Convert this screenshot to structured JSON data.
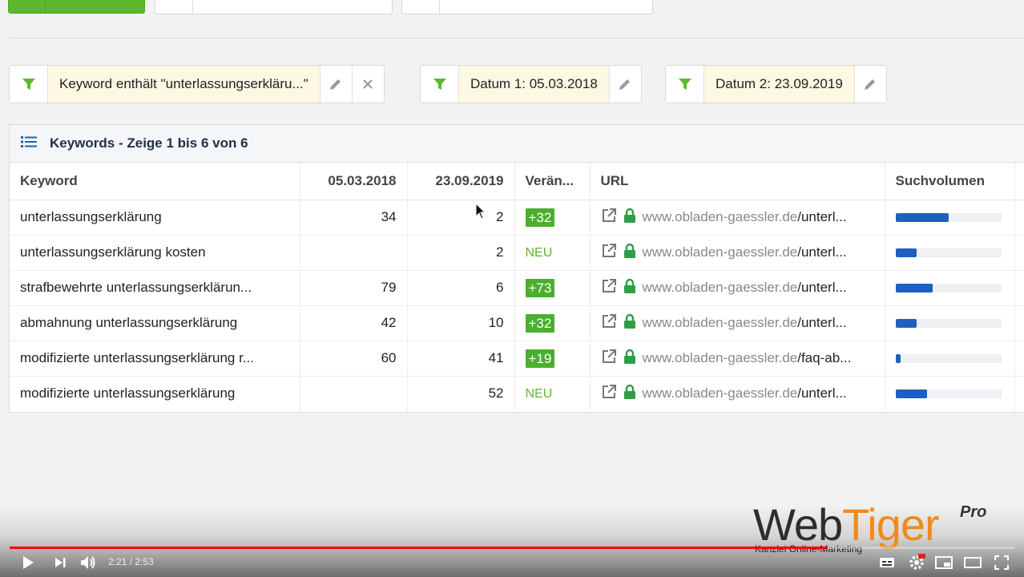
{
  "filters": [
    {
      "label": "Keyword enthält \"unterlassungserkläru...\"",
      "removable": true
    },
    {
      "label": "Datum 1: 05.03.2018",
      "removable": false
    },
    {
      "label": "Datum 2: 23.09.2019",
      "removable": false
    }
  ],
  "panel": {
    "title": "Keywords - Zeige 1 bis 6 von 6",
    "columns": [
      "Keyword",
      "05.03.2018",
      "23.09.2019",
      "Verän...",
      "URL",
      "Suchvolumen"
    ]
  },
  "rows": [
    {
      "keyword": "unterlassungserklärung",
      "d1": "34",
      "d2": "2",
      "change": "+32",
      "is_new": false,
      "domain": "www.obladen-gaessler.de",
      "path": "/unterl...",
      "volume": 0.5
    },
    {
      "keyword": "unterlassungserklärung kosten",
      "d1": "",
      "d2": "2",
      "change": "NEU",
      "is_new": true,
      "domain": "www.obladen-gaessler.de",
      "path": "/unterl...",
      "volume": 0.2
    },
    {
      "keyword": "strafbewehrte unterlassungserklärun...",
      "d1": "79",
      "d2": "6",
      "change": "+73",
      "is_new": false,
      "domain": "www.obladen-gaessler.de",
      "path": "/unterl...",
      "volume": 0.35
    },
    {
      "keyword": "abmahnung unterlassungserklärung",
      "d1": "42",
      "d2": "10",
      "change": "+32",
      "is_new": false,
      "domain": "www.obladen-gaessler.de",
      "path": "/unterl...",
      "volume": 0.2
    },
    {
      "keyword": "modifizierte unterlassungserklärung r...",
      "d1": "60",
      "d2": "41",
      "change": "+19",
      "is_new": false,
      "domain": "www.obladen-gaessler.de",
      "path": "/faq-ab...",
      "volume": 0.05
    },
    {
      "keyword": "modifizierte unterlassungserklärung",
      "d1": "",
      "d2": "52",
      "change": "NEU",
      "is_new": true,
      "domain": "www.obladen-gaessler.de",
      "path": "/unterl...",
      "volume": 0.3
    }
  ],
  "colors": {
    "accent_green": "#5cb82f",
    "bar_blue": "#1f5fbf",
    "chip_bg": "#fdf8e4",
    "progress_red": "#ff0000"
  },
  "player": {
    "time": "2:21 / 2:53",
    "progress": 0.814
  },
  "logo": {
    "web": "Web",
    "tiger": "Tiger",
    "pro": "Pro",
    "subtitle": "Kanzlei Online-Marketing"
  }
}
